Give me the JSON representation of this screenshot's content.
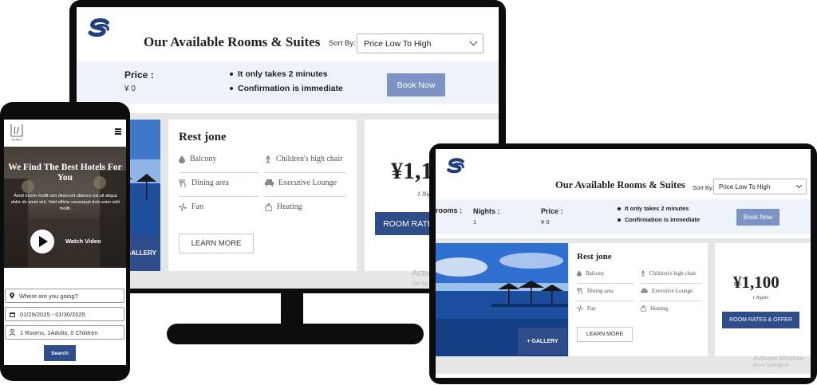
{
  "desktop": {
    "title": "Our Available Rooms & Suites",
    "sort_label": "Sort By:",
    "sort_value": "Price Low To High",
    "price_label": "Price :",
    "price_value": "¥ 0",
    "bullets": [
      "It only takes 2 minutes",
      "Confirmation is immediate"
    ],
    "book_label": "Book Now",
    "room": {
      "name": "Rest jone",
      "amenities_left": [
        {
          "icon": "drop-icon",
          "label": "Balcony"
        },
        {
          "icon": "utensils-icon",
          "label": "Dining area"
        },
        {
          "icon": "fan-icon",
          "label": "Fan"
        }
      ],
      "amenities_right": [
        {
          "icon": "child-icon",
          "label": "Children's high chair"
        },
        {
          "icon": "sofa-icon",
          "label": "Executive Lounge"
        },
        {
          "icon": "flame-icon",
          "label": "Heating"
        }
      ],
      "learn_more": "LEARN MORE",
      "gallery": "GALLERY",
      "price": "¥1,1",
      "nights": "1 Nights",
      "rates_label": "ROOM RATES"
    },
    "watermark": [
      "Activ",
      "Go to"
    ]
  },
  "phone": {
    "hotel_logo_text": "HOTELA",
    "hero_title": "We Find The Best Hotels For You",
    "hero_sub": "Amet minim mollit non deserunt ullamco est sit aliqua dolor do amet sint. Velit officia consequat duis enim velit mollit.",
    "watch_label": "Watch Video",
    "where_placeholder": "Where are you going?",
    "dates": "01/29/2025 - 01/30/2025",
    "guests": "1 Rooms, 1Adults, 0 Children",
    "search_label": "Search"
  },
  "tablet": {
    "title": "Our Available Rooms & Suites",
    "sort_label": "Sort By:",
    "sort_value": "Price Low To High",
    "rooms_label": "rooms :",
    "nights_label": "Nights :",
    "nights_value": "1",
    "price_label": "Price :",
    "price_value": "¥ 0",
    "bullets": [
      "It only takes 2 minutes",
      "Confirmation is immediate"
    ],
    "book_label": "Book Now",
    "room": {
      "name": "Rest jone",
      "amenities_left": [
        {
          "icon": "drop-icon",
          "label": "Balcony"
        },
        {
          "icon": "utensils-icon",
          "label": "Dining area"
        },
        {
          "icon": "fan-icon",
          "label": "Fan"
        }
      ],
      "amenities_right": [
        {
          "icon": "child-icon",
          "label": "Children's high chair"
        },
        {
          "icon": "sofa-icon",
          "label": "Executive Lounge"
        },
        {
          "icon": "flame-icon",
          "label": "Heating"
        }
      ],
      "learn_more": "LEARN MORE",
      "gallery": "+ GALLERY",
      "price": "¥1,100",
      "nights": "1 Nights",
      "rates_label": "ROOM RATES & OFFER"
    },
    "watermark": [
      "Activate Window",
      "Go to Settings to"
    ]
  },
  "colors": {
    "accent": "#2e4d8a",
    "book_button": "#7c93c3",
    "band": "#eef2fa",
    "device": "#0c0c0c"
  }
}
